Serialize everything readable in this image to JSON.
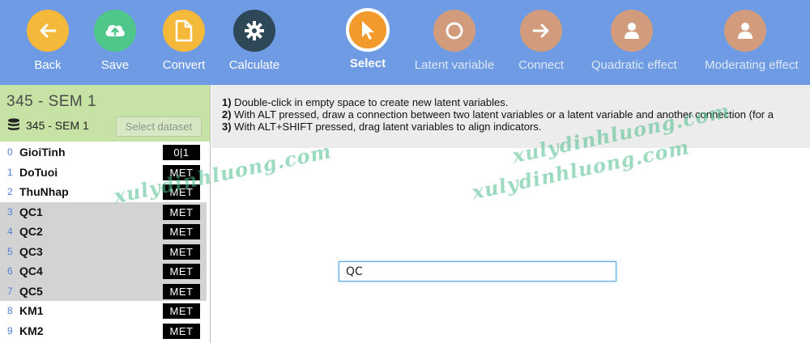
{
  "toolbar": {
    "items": [
      {
        "label": "Back",
        "icon": "back-arrow-icon",
        "color": "#f4b93a"
      },
      {
        "label": "Save",
        "icon": "cloud-upload-icon",
        "color": "#4fc78a"
      },
      {
        "label": "Convert",
        "icon": "document-icon",
        "color": "#f4b93a"
      },
      {
        "label": "Calculate",
        "icon": "gear-icon",
        "color": "#2f4858"
      },
      {
        "label": "Select",
        "icon": "cursor-icon",
        "color": "#f29b2c"
      },
      {
        "label": "Latent variable",
        "icon": "circle-icon",
        "color": "#d29c7c"
      },
      {
        "label": "Connect",
        "icon": "right-arrow-icon",
        "color": "#d29c7c"
      },
      {
        "label": "Quadratic effect",
        "icon": "person-icon",
        "color": "#d29c7c"
      },
      {
        "label": "Moderating effect",
        "icon": "person-icon",
        "color": "#d29c7c"
      }
    ]
  },
  "dataset": {
    "title": "345 - SEM 1",
    "name": "345 - SEM 1",
    "select_button": "Select dataset"
  },
  "variables": [
    {
      "index": "0",
      "name": "GioiTinh",
      "type": "0|1"
    },
    {
      "index": "1",
      "name": "DoTuoi",
      "type": "MET"
    },
    {
      "index": "2",
      "name": "ThuNhap",
      "type": "MET"
    },
    {
      "index": "3",
      "name": "QC1",
      "type": "MET"
    },
    {
      "index": "4",
      "name": "QC2",
      "type": "MET"
    },
    {
      "index": "5",
      "name": "QC3",
      "type": "MET"
    },
    {
      "index": "6",
      "name": "QC4",
      "type": "MET"
    },
    {
      "index": "7",
      "name": "QC5",
      "type": "MET"
    },
    {
      "index": "8",
      "name": "KM1",
      "type": "MET"
    },
    {
      "index": "9",
      "name": "KM2",
      "type": "MET"
    }
  ],
  "instructions": {
    "line1_num": "1)",
    "line1": " Double-click in empty space to create new latent variables.",
    "line2_num": "2)",
    "line2": " With ALT pressed, draw a connection between two latent variables or a latent variable and another connection (for a",
    "line3_num": "3)",
    "line3": " With ALT+SHIFT pressed, drag latent variables to align indicators."
  },
  "latent_input": {
    "value": "QC"
  },
  "watermarks": [
    "xulydinhluong.com",
    "xulydinhluong.com",
    "xulydinhluong.com"
  ]
}
